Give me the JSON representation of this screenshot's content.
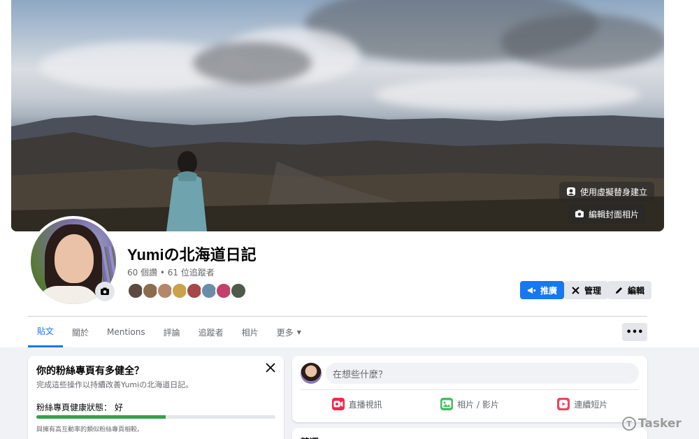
{
  "cover": {
    "avatar_button_label": "使用虛擬替身建立",
    "edit_cover_label": "編輯封面相片"
  },
  "profile": {
    "name": "Yumiの北海道日記",
    "stats": "60 個讚 • 61 位追蹤者"
  },
  "actions": {
    "promote": "推廣",
    "manage": "管理",
    "edit": "編輯",
    "more": "•••"
  },
  "tabs": [
    {
      "label": "貼文",
      "active": true
    },
    {
      "label": "關於"
    },
    {
      "label": "Mentions"
    },
    {
      "label": "評論"
    },
    {
      "label": "追蹤者"
    },
    {
      "label": "相片"
    },
    {
      "label": "更多"
    }
  ],
  "health_card": {
    "title": "你的粉絲專頁有多健全？",
    "subtitle": "完成這些操作以持續改善Yumiの北海道日記。",
    "status": "粉絲專頁健康狀態： 好",
    "progress": 0.54,
    "note": "與擁有高互動率的類似粉絲專頁相較。"
  },
  "composer": {
    "placeholder": "在想些什麼？",
    "live_label": "直播視訊",
    "photo_label": "相片 / 影片",
    "reels_label": "連續短片"
  },
  "featured": {
    "title": "精選"
  },
  "watermark": {
    "text": "Tasker"
  },
  "colors": {
    "accent": "#1877f2",
    "health_bar": "#31a24c",
    "live_icon": "#f02849",
    "photo_icon": "#45bd62",
    "reels_icon": "#f3425f"
  }
}
